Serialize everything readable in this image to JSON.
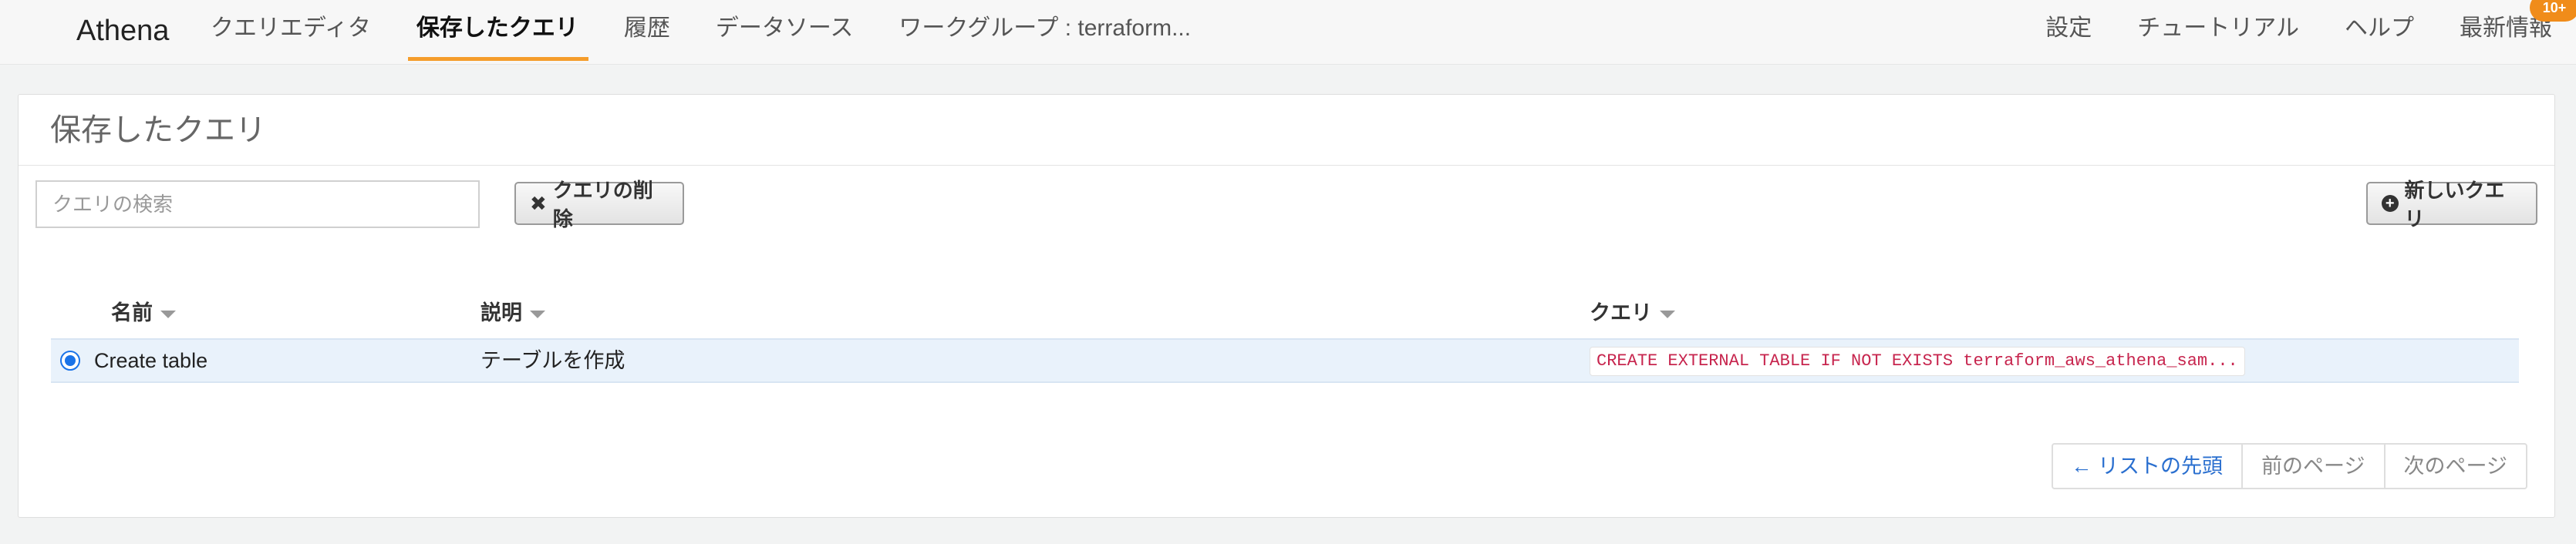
{
  "nav": {
    "brand": "Athena",
    "left_items": [
      "クエリエディタ",
      "保存したクエリ",
      "履歴",
      "データソース",
      "ワークグループ : terraform..."
    ],
    "active_index": 1,
    "right_items": [
      "設定",
      "チュートリアル",
      "ヘルプ",
      "最新情報"
    ],
    "badge": "10+"
  },
  "panel": {
    "title": "保存したクエリ",
    "search_placeholder": "クエリの検索",
    "delete_label": "クエリの削除",
    "new_label": "新しいクエリ"
  },
  "table": {
    "columns": [
      "名前",
      "説明",
      "クエリ"
    ],
    "rows": [
      {
        "name": "Create table",
        "description": "テーブルを作成",
        "query": "CREATE EXTERNAL TABLE IF NOT EXISTS terraform_aws_athena_sam...",
        "selected": true
      }
    ]
  },
  "pagination": {
    "first": "← リストの先頭",
    "prev": "前のページ",
    "next": "次のページ"
  },
  "colors": {
    "accent": "#f59d2b",
    "link": "#2a6fcf",
    "code": "#c7254e",
    "selected_row": "#e9f2fb"
  }
}
